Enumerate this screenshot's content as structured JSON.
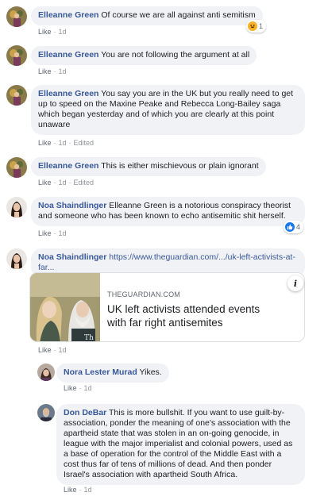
{
  "comments": [
    {
      "author": "Elleanne Green",
      "text": "Of course we are all against anti semitism",
      "like": "Like",
      "time": "1d",
      "reaction_count": "1"
    },
    {
      "author": "Elleanne Green",
      "text": "You are not following the argument at all",
      "like": "Like",
      "time": "1d"
    },
    {
      "author": "Elleanne Green",
      "text": "You say you are in the UK but you really need to get up to speed on the Maxine Peake and Rebecca Long-Bailey saga which began yesterday and of which you are clearly at this point unaware",
      "like": "Like",
      "time": "1d",
      "edited": "Edited"
    },
    {
      "author": "Elleanne Green",
      "text": "This is either mischievous or plain ignorant",
      "like": "Like",
      "time": "1d",
      "edited": "Edited"
    },
    {
      "author": "Noa Shaindlinger",
      "text": "Elleanne Green is a notorious conspiracy theorist and someone who has been known to echo antisemitic shit herself.",
      "like": "Like",
      "time": "1d",
      "reaction_count": "4"
    },
    {
      "author": "Noa Shaindlinger",
      "link": "https://www.theguardian.com/.../uk-left-activists-at-far...",
      "like": "Like",
      "time": "1d"
    }
  ],
  "preview": {
    "domain": "THEGUARDIAN.COM",
    "title": "UK left activists attended events with far right antisemites",
    "info": "i"
  },
  "replies": [
    {
      "author": "Nora Lester Murad",
      "text": "Yikes.",
      "like": "Like",
      "time": "1d"
    },
    {
      "author": "Don DeBar",
      "text": "This is more bullshit. If you want to use guilt-by-association, ponder the meaning of one's association with the apartheid state that was stolen in an on-going genocide, in league with the major imperialist and colonial powers, used as a base of operation for the control of the Middle East with a cost thus far of tens of millions of dead. And then ponder Israel's association with apartheid South Africa.",
      "like": "Like",
      "time": "1d"
    }
  ],
  "colors": {
    "name": "#385898",
    "bubble": "#f0f2f5",
    "meta": "#90949c",
    "like_blue": "#1877f2",
    "haha_yellow": "#f7b125"
  }
}
